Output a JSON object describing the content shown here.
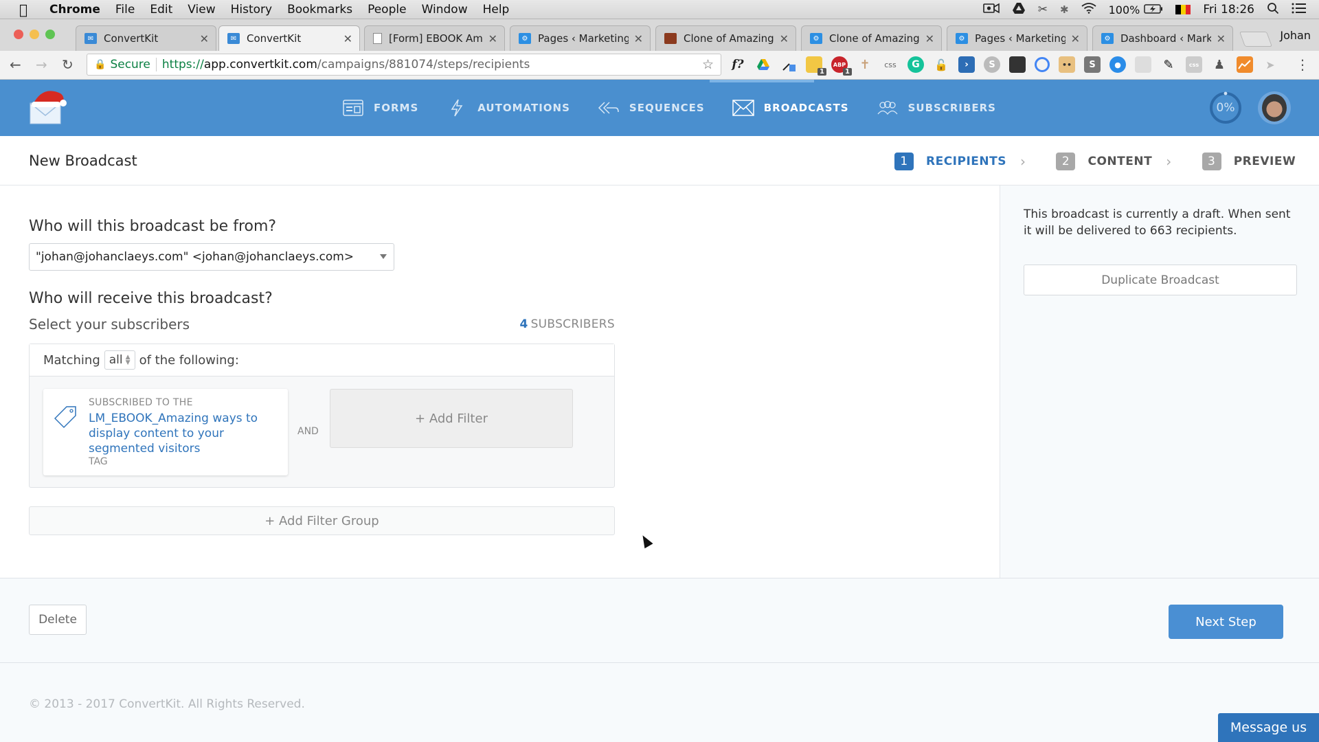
{
  "menubar": {
    "app": "Chrome",
    "items": [
      "File",
      "Edit",
      "View",
      "History",
      "Bookmarks",
      "People",
      "Window",
      "Help"
    ],
    "battery": "100%",
    "clock": "Fri 18:26"
  },
  "browser": {
    "tabs": [
      {
        "title": "ConvertKit",
        "favicon": "convertkit-icon",
        "active": false
      },
      {
        "title": "ConvertKit",
        "favicon": "convertkit-icon",
        "active": true
      },
      {
        "title": "[Form] EBOOK Am",
        "favicon": "document-icon",
        "active": false
      },
      {
        "title": "Pages ‹ Marketing",
        "favicon": "gear-site-icon",
        "active": false
      },
      {
        "title": "Clone of Amazing",
        "favicon": "photo-icon",
        "active": false
      },
      {
        "title": "Clone of Amazing",
        "favicon": "gear-site-icon",
        "active": false
      },
      {
        "title": "Pages ‹ Marketing",
        "favicon": "gear-site-icon",
        "active": false
      },
      {
        "title": "Dashboard ‹ Mark",
        "favicon": "gear-site-icon",
        "active": false
      }
    ],
    "profile_name": "Johan",
    "secure_label": "Secure",
    "url": {
      "scheme": "https://",
      "host": "app.convertkit.com",
      "path": "/campaigns/881074/steps/recipients"
    },
    "extension_badges": {
      "ext3": "1",
      "ext4": "1"
    }
  },
  "nav": {
    "items": [
      {
        "label": "FORMS",
        "icon": "forms-icon",
        "active": false
      },
      {
        "label": "AUTOMATIONS",
        "icon": "lightning-icon",
        "active": false
      },
      {
        "label": "SEQUENCES",
        "icon": "sequences-icon",
        "active": false
      },
      {
        "label": "BROADCASTS",
        "icon": "envelope-icon",
        "active": true
      },
      {
        "label": "SUBSCRIBERS",
        "icon": "people-icon",
        "active": false
      }
    ],
    "progress": "0%"
  },
  "header": {
    "title": "New Broadcast",
    "steps": [
      {
        "num": "1",
        "label": "RECIPIENTS",
        "active": true
      },
      {
        "num": "2",
        "label": "CONTENT",
        "active": false
      },
      {
        "num": "3",
        "label": "PREVIEW",
        "active": false
      }
    ]
  },
  "form": {
    "from_question": "Who will this broadcast be from?",
    "from_value": "\"johan@johanclaeys.com\" <johan@johanclaeys.com>",
    "receive_question": "Who will receive this broadcast?",
    "select_label": "Select your subscribers",
    "subscriber_count": "4",
    "subscriber_count_label": "SUBSCRIBERS",
    "filter_group": {
      "matching_prefix": "Matching",
      "matching_value": "all",
      "matching_suffix": "of the following:",
      "filter": {
        "prefix": "SUBSCRIBED TO THE",
        "name": "LM_EBOOK_Amazing ways to display content to your segmented visitors",
        "type": "TAG"
      },
      "and_label": "AND",
      "add_filter_label": "+ Add Filter"
    },
    "add_filter_group_label": "+ Add Filter Group"
  },
  "sidebar": {
    "note": "This broadcast is currently a draft. When sent it will be delivered to 663 recipients.",
    "duplicate_label": "Duplicate Broadcast"
  },
  "actions": {
    "delete_label": "Delete",
    "next_label": "Next Step"
  },
  "footer": {
    "copyright": "© 2013 - 2017 ConvertKit. All Rights Reserved.",
    "message_us": "Message us"
  }
}
